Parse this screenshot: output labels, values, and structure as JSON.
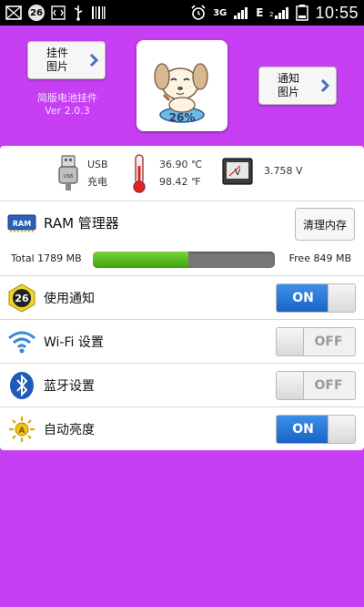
{
  "status_bar": {
    "battery_badge": "26",
    "network_3g": "3G",
    "network_e": "E",
    "time": "10:55"
  },
  "header": {
    "widget_button_label": "挂件\n图片",
    "notify_button_label": "通知\n图片",
    "app_name": "简版电池挂件",
    "version": "Ver 2.0.3",
    "battery_percent": "26%"
  },
  "info": {
    "usb_label": "USB",
    "charge_label": "充电",
    "temp_c": "36.90 ℃",
    "temp_f": "98.42 ℉",
    "voltage": "3.758 V"
  },
  "ram": {
    "icon_text": "RAM",
    "title": "RAM 管理器",
    "clean_button": "清理内存",
    "total": "Total 1789 MB",
    "free": "Free 849 MB",
    "used_fraction": 0.525
  },
  "toggles": [
    {
      "label": "使用通知",
      "state": "ON",
      "on": true,
      "badge": "26"
    },
    {
      "label": "Wi-Fi 设置",
      "state": "OFF",
      "on": false
    },
    {
      "label": "蓝牙设置",
      "state": "OFF",
      "on": false
    },
    {
      "label": "自动亮度",
      "state": "ON",
      "on": true
    }
  ],
  "colors": {
    "background": "#c63ff2",
    "switch_on": "#2a78dc",
    "ram_used": "#4fb81e"
  }
}
